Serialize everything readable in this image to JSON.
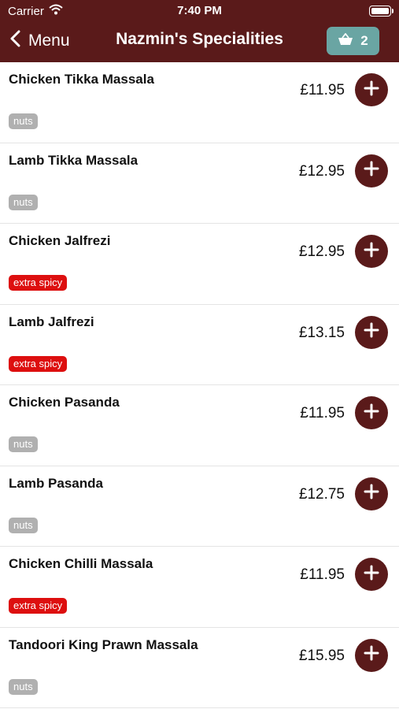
{
  "status_bar": {
    "carrier": "Carrier",
    "time": "7:40 PM",
    "icons": [
      "wifi-icon",
      "battery-icon"
    ]
  },
  "nav": {
    "back_label": "Menu",
    "title": "Nazmin's Specialities",
    "basket_count": "2",
    "icons": [
      "chevron-left-icon",
      "basket-icon"
    ]
  },
  "colors": {
    "header": "#5a1a1a",
    "basket": "#6aa5a3",
    "nuts_tag": "#b0b0b0",
    "spicy_tag": "#dd0f0f"
  },
  "items": [
    {
      "name": "Chicken Tikka Massala",
      "price": "£11.95",
      "tag": "nuts",
      "tag_type": "nuts"
    },
    {
      "name": "Lamb Tikka Massala",
      "price": "£12.95",
      "tag": "nuts",
      "tag_type": "nuts"
    },
    {
      "name": "Chicken Jalfrezi",
      "price": "£12.95",
      "tag": "extra spicy",
      "tag_type": "spicy"
    },
    {
      "name": "Lamb Jalfrezi",
      "price": "£13.15",
      "tag": "extra spicy",
      "tag_type": "spicy"
    },
    {
      "name": "Chicken Pasanda",
      "price": "£11.95",
      "tag": "nuts",
      "tag_type": "nuts"
    },
    {
      "name": "Lamb Pasanda",
      "price": "£12.75",
      "tag": "nuts",
      "tag_type": "nuts"
    },
    {
      "name": "Chicken Chilli Massala",
      "price": "£11.95",
      "tag": "extra spicy",
      "tag_type": "spicy"
    },
    {
      "name": "Tandoori King Prawn Massala",
      "price": "£15.95",
      "tag": "nuts",
      "tag_type": "nuts"
    }
  ]
}
